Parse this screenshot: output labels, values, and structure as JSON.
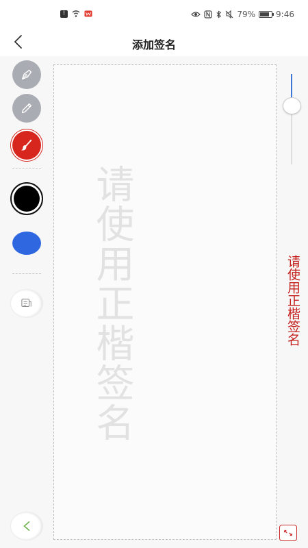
{
  "status_bar": {
    "left_icons": [
      "alert-icon",
      "wifi-icon",
      "app-notification-icon"
    ],
    "right_icons": [
      "eye-icon",
      "nfc-icon",
      "bluetooth-icon",
      "mute-icon"
    ],
    "battery_percent": "79%",
    "battery_level": 0.79,
    "time": "9:46"
  },
  "navbar": {
    "back_icon": "chevron-left-icon",
    "title": "添加签名"
  },
  "toolbar": {
    "tools": [
      {
        "name": "fountain-pen",
        "icon": "fountain-pen-icon",
        "selected": false
      },
      {
        "name": "pencil",
        "icon": "pencil-icon",
        "selected": false
      },
      {
        "name": "brush",
        "icon": "brush-icon",
        "selected": true
      }
    ],
    "colors": [
      {
        "name": "black",
        "hex": "#000000",
        "selected": true
      },
      {
        "name": "blue",
        "hex": "#2e67e0",
        "selected": false
      }
    ],
    "extra_button_icon": "note-icon",
    "undo_button_icon": "undo-arrow-icon"
  },
  "canvas": {
    "watermark": "请使用正楷签名"
  },
  "stroke_slider": {
    "value": 0.35,
    "accent": "#3d78d8"
  },
  "hint": {
    "text": "请使用正楷签名",
    "color": "#c41f1c"
  },
  "bottom_right_icon": "exit-fullscreen-icon"
}
